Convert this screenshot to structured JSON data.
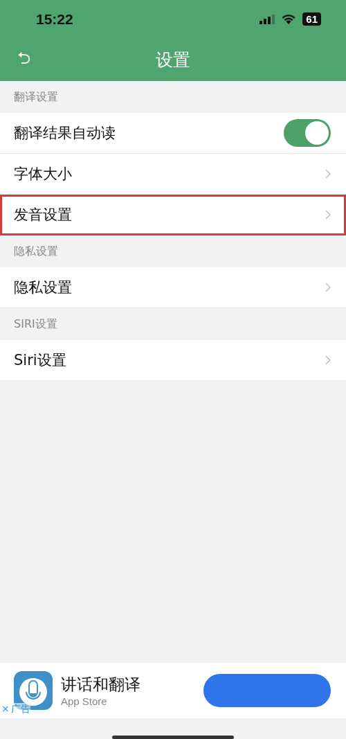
{
  "status_bar": {
    "time": "15:22",
    "battery": "61"
  },
  "nav_bar": {
    "back": "⮌",
    "title": "设置"
  },
  "sections": [
    {
      "header": "翻译设置",
      "rows": [
        {
          "kind": "toggle",
          "label": "翻译结果自动读",
          "on": true,
          "highlighted": false
        },
        {
          "kind": "link",
          "label": "字体大小",
          "highlighted": false
        },
        {
          "kind": "link",
          "label": "发音设置",
          "highlighted": true
        }
      ]
    },
    {
      "header": "隐私设置",
      "rows": [
        {
          "kind": "link",
          "label": "隐私设置",
          "highlighted": false
        }
      ]
    },
    {
      "header": "SIRI设置",
      "rows": [
        {
          "kind": "link",
          "label": "Siri设置",
          "highlighted": false
        }
      ]
    }
  ],
  "ad": {
    "app_name": "讲话和翻译",
    "store": "App Store",
    "close": "×",
    "ad_label": "广告"
  }
}
